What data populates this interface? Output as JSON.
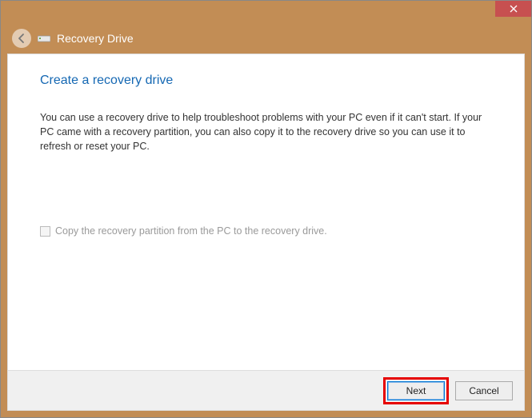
{
  "titlebar": {
    "close_label": "Close"
  },
  "header": {
    "title": "Recovery Drive"
  },
  "content": {
    "heading": "Create a recovery drive",
    "description": "You can use a recovery drive to help troubleshoot problems with your PC even if it can't start. If your PC came with a recovery partition, you can also copy it to the recovery drive so you can use it to refresh or reset your PC.",
    "checkbox_label": "Copy the recovery partition from the PC to the recovery drive."
  },
  "footer": {
    "next_label": "Next",
    "cancel_label": "Cancel"
  }
}
